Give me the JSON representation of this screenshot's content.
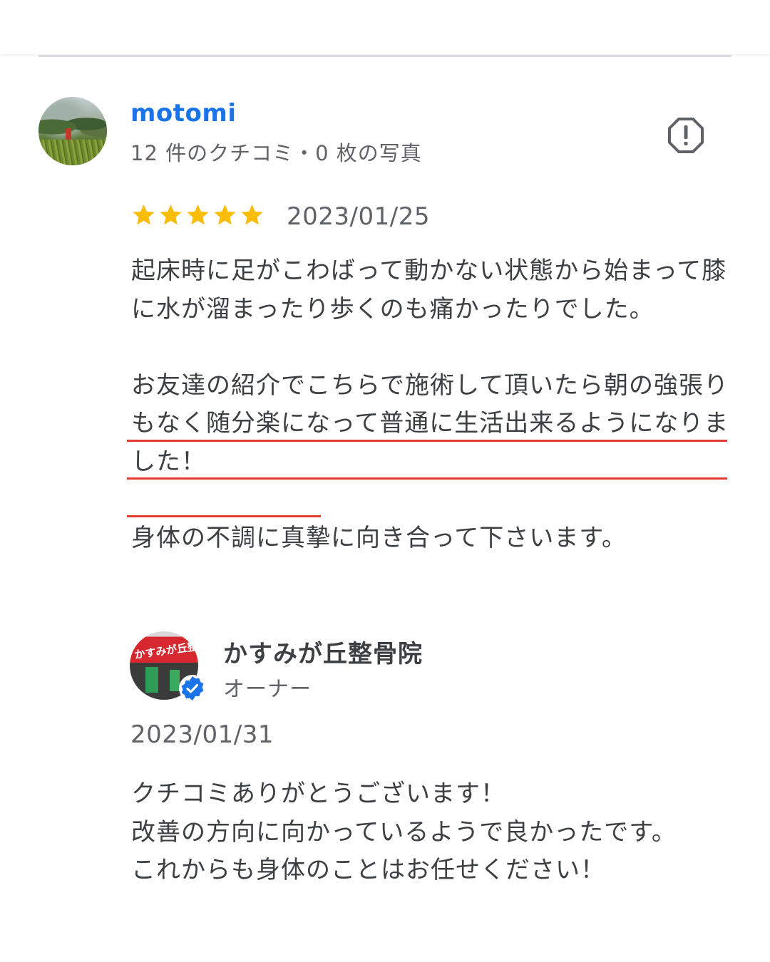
{
  "review": {
    "reviewer_name": "motomi",
    "reviewer_meta": "12 件のクチコミ・0 枚の写真",
    "rating": 5,
    "date": "2023/01/25",
    "paragraphs": {
      "p1": "起床時に足がこわばって動かない状態から始まって膝に水が溜まったり歩くのも痛かったりでした。",
      "p2": "お友達の紹介でこちらで施術して頂いたら朝の強張りもなく随分楽になって普通に生活出来るようになりました！",
      "p3": "身体の不調に真摯に向き合って下さいます。"
    }
  },
  "icons": {
    "report": "report-icon",
    "star": "star-icon",
    "verified": "verified-badge-icon"
  },
  "colors": {
    "name_link": "#1a73e8",
    "star": "#fbbc04",
    "highlight_underline": "#e53935",
    "verified": "#1a73e8"
  },
  "owner_reply": {
    "name": "かすみが丘整骨院",
    "role": "オーナー",
    "date": "2023/01/31",
    "lines": [
      "クチコミありがとうございます！",
      "改善の方向に向かっているようで良かったです。",
      "これからも身体のことはお任せください！"
    ]
  }
}
